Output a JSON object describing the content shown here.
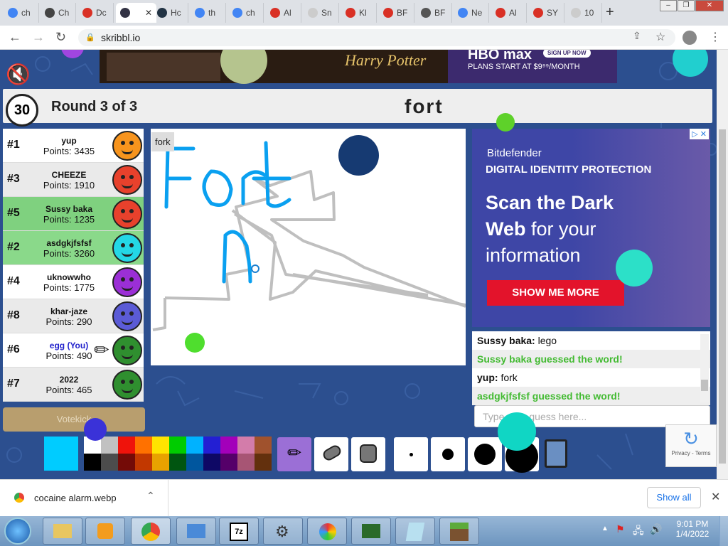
{
  "browser": {
    "tabs": [
      {
        "label": "ch",
        "icon": "google-icon",
        "color": "#4285f4"
      },
      {
        "label": "Ch",
        "icon": "gear-icon",
        "color": "#444"
      },
      {
        "label": "Dc",
        "icon": "gmail-icon",
        "color": "#d93025"
      },
      {
        "label": "",
        "icon": "skribbl-icon",
        "color": "#334"
      },
      {
        "label": "Hc",
        "icon": "globe-icon",
        "color": "#234"
      },
      {
        "label": "th",
        "icon": "google-icon",
        "color": "#4285f4"
      },
      {
        "label": "ch",
        "icon": "google-icon",
        "color": "#4285f4"
      },
      {
        "label": "Al",
        "icon": "g-red-icon",
        "color": "#d93025"
      },
      {
        "label": "Sn",
        "icon": "blank-icon",
        "color": "#ccc"
      },
      {
        "label": "Kl",
        "icon": "g-red-icon",
        "color": "#d93025"
      },
      {
        "label": "BF",
        "icon": "g-red-icon",
        "color": "#d93025"
      },
      {
        "label": "BF",
        "icon": "globe-icon",
        "color": "#555"
      },
      {
        "label": "Ne",
        "icon": "google-icon",
        "color": "#4285f4"
      },
      {
        "label": "Al",
        "icon": "g-red-icon",
        "color": "#d93025"
      },
      {
        "label": "SY",
        "icon": "g-red-icon",
        "color": "#d93025"
      },
      {
        "label": "10",
        "icon": "blank-icon",
        "color": "#ccc"
      }
    ],
    "url": "skribbl.io"
  },
  "ad_top": {
    "brand": "Harry Potter",
    "service": "HBO max",
    "cta": "SIGN UP NOW",
    "offer": "PLANS START AT $9⁹⁹/MONTH"
  },
  "game": {
    "timer": "30",
    "round": "Round 3 of 3",
    "word": "fort",
    "bubble": "fork",
    "votekick": "Votekick"
  },
  "players": [
    {
      "rank": "#1",
      "name": "yup",
      "points": "Points: 3435",
      "guessed": false,
      "you": false,
      "avatar_color": "#f7941d"
    },
    {
      "rank": "#3",
      "name": "CHEEZE",
      "points": "Points: 1910",
      "guessed": false,
      "you": false,
      "avatar_color": "#e8412c"
    },
    {
      "rank": "#5",
      "name": "Sussy baka",
      "points": "Points: 1235",
      "guessed": true,
      "you": false,
      "avatar_color": "#e8412c"
    },
    {
      "rank": "#2",
      "name": "asdgkjfsfsf",
      "points": "Points: 3260",
      "guessed": true,
      "you": false,
      "avatar_color": "#24d7e6"
    },
    {
      "rank": "#4",
      "name": "uknowwho",
      "points": "Points: 1775",
      "guessed": false,
      "you": false,
      "avatar_color": "#9b2fd6"
    },
    {
      "rank": "#8",
      "name": "khar-jaze",
      "points": "Points: 290",
      "guessed": false,
      "you": false,
      "avatar_color": "#5b5bd6"
    },
    {
      "rank": "#6",
      "name": "egg (You)",
      "points": "Points: 490",
      "guessed": false,
      "you": true,
      "avatar_color": "#2f8f2f"
    },
    {
      "rank": "#7",
      "name": "2022",
      "points": "Points: 465",
      "guessed": false,
      "you": false,
      "avatar_color": "#2f8f2f"
    }
  ],
  "ad_side": {
    "brand": "Bitdefender",
    "subhead": "DIGITAL IDENTITY PROTECTION",
    "headline_bold": "Scan the Dark Web",
    "headline_rest": " for your information",
    "cta": "SHOW ME MORE"
  },
  "chat": {
    "messages": [
      {
        "user": "Sussy baka:",
        "text": " lego",
        "type": "normal"
      },
      {
        "user": "",
        "text": "Sussy baka guessed the word!",
        "type": "green"
      },
      {
        "user": "yup:",
        "text": " fork",
        "type": "normal"
      },
      {
        "user": "",
        "text": "asdgkjfsfsf guessed the word!",
        "type": "green"
      }
    ],
    "placeholder": "Type your guess here..."
  },
  "recaptcha": {
    "label": "Privacy - Terms"
  },
  "palette": {
    "current": "#00ccff",
    "top": [
      "#ffffff",
      "#c1c1c1",
      "#ef130b",
      "#ff7100",
      "#ffe400",
      "#00cc00",
      "#00b2ff",
      "#231fd3",
      "#a300ba",
      "#d37caa",
      "#a0522d"
    ],
    "bottom": [
      "#000000",
      "#4c4c4c",
      "#740b07",
      "#c23800",
      "#e8a200",
      "#005510",
      "#00569e",
      "#0e0865",
      "#550069",
      "#a75574",
      "#63300d"
    ]
  },
  "download": {
    "filename": "cocaine alarm.webp",
    "show_all": "Show all"
  },
  "taskbar": {
    "time": "9:01 PM",
    "date": "1/4/2022"
  }
}
